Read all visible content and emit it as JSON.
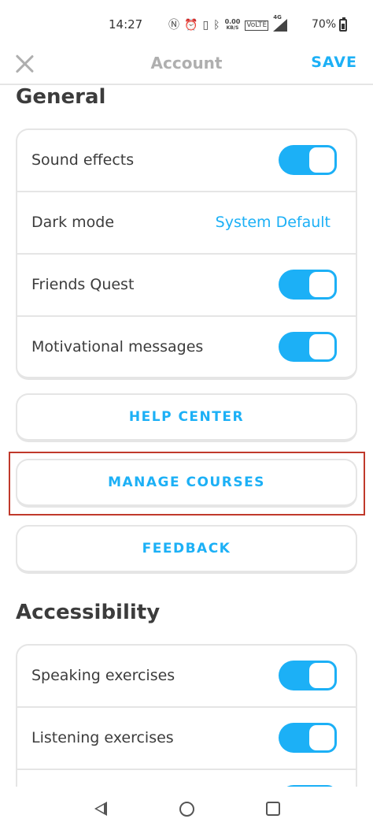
{
  "status_bar": {
    "time": "14:27",
    "speed_value": "0.00",
    "speed_unit": "KB/S",
    "network": "4G",
    "battery": "70%",
    "icons": [
      "nfc-icon",
      "alarm-icon",
      "vibrate-icon",
      "bluetooth-icon",
      "speed-icon",
      "volte-icon",
      "signal-icon",
      "battery-icon"
    ]
  },
  "header": {
    "title": "Account",
    "save_label": "SAVE",
    "close_icon": "close-icon"
  },
  "general": {
    "title": "General",
    "settings": [
      {
        "label": "Sound effects",
        "type": "toggle",
        "on": true
      },
      {
        "label": "Dark mode",
        "type": "value",
        "value": "System Default"
      },
      {
        "label": "Friends Quest",
        "type": "toggle",
        "on": true
      },
      {
        "label": "Motivational messages",
        "type": "toggle",
        "on": true
      }
    ]
  },
  "buttons": {
    "help_center": "HELP CENTER",
    "manage_courses": "MANAGE COURSES",
    "feedback": "FEEDBACK"
  },
  "accessibility": {
    "title": "Accessibility",
    "settings": [
      {
        "label": "Speaking exercises",
        "type": "toggle",
        "on": true
      },
      {
        "label": "Listening exercises",
        "type": "toggle",
        "on": true
      },
      {
        "label": "",
        "type": "toggle",
        "on": true
      }
    ]
  },
  "colors": {
    "accent": "#1cb0f6",
    "border": "#e5e5e5",
    "text": "#3c3c3c",
    "muted": "#afafaf",
    "highlight": "#c0392b"
  },
  "nav": {
    "icons": [
      "back-icon",
      "home-icon",
      "recents-icon"
    ]
  }
}
